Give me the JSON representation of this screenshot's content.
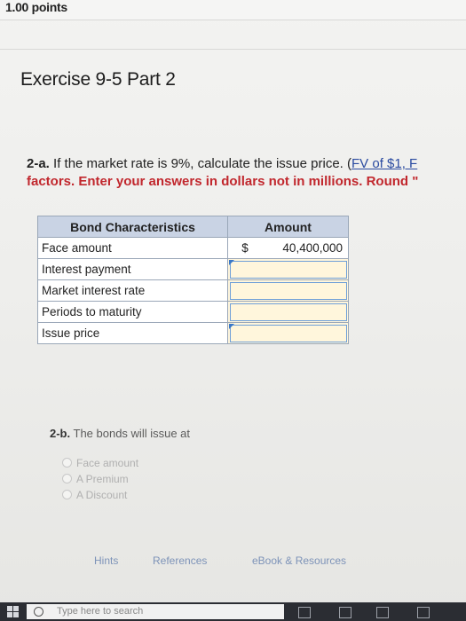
{
  "header": {
    "points": "1.00 points"
  },
  "exercise": {
    "title": "Exercise 9-5 Part 2"
  },
  "question": {
    "num": "2-a.",
    "text_before_link": " If the market rate is 9%, calculate the issue price. (",
    "link": "FV of $1, F",
    "instruction": "factors. Enter your answers in dollars not in millions. Round \""
  },
  "table": {
    "headers": [
      "Bond Characteristics",
      "Amount"
    ],
    "rows": [
      {
        "label": "Face amount",
        "currency": "$",
        "value": "40,400,000"
      },
      {
        "label": "Interest payment",
        "currency": "",
        "value": ""
      },
      {
        "label": "Market interest rate",
        "currency": "",
        "value": ""
      },
      {
        "label": "Periods to maturity",
        "currency": "",
        "value": ""
      },
      {
        "label": "Issue price",
        "currency": "",
        "value": ""
      }
    ]
  },
  "part_b": {
    "num": "2-b.",
    "text": " The bonds will issue at",
    "options": [
      "Face amount",
      "A Premium",
      "A Discount"
    ]
  },
  "links": {
    "hints": "Hints",
    "references": "References",
    "ebook": "eBook & Resources"
  },
  "taskbar": {
    "search_placeholder": "Type here to search"
  }
}
